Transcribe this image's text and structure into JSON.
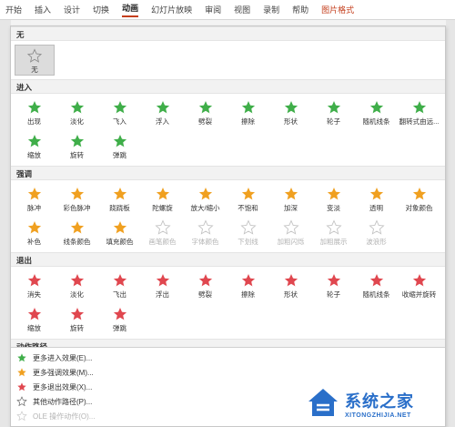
{
  "ribbon": {
    "tabs": [
      "开始",
      "插入",
      "设计",
      "切换",
      "动画",
      "幻灯片放映",
      "审阅",
      "视图",
      "录制",
      "帮助",
      "图片格式"
    ],
    "active_index": 4,
    "accent_index": 10
  },
  "none_section": {
    "header": "无",
    "item_label": "无"
  },
  "entrance": {
    "header": "进入",
    "color": "#3fae49",
    "items": [
      "出现",
      "淡化",
      "飞入",
      "浮入",
      "劈裂",
      "擦除",
      "形状",
      "轮子",
      "随机线条",
      "翻转式由远...",
      "缩放",
      "旋转",
      "弹跳"
    ]
  },
  "emphasis": {
    "header": "强调",
    "color": "#f0a020",
    "items": [
      {
        "label": "脉冲",
        "disabled": false
      },
      {
        "label": "彩色脉冲",
        "disabled": false
      },
      {
        "label": "跷跷板",
        "disabled": false
      },
      {
        "label": "陀螺旋",
        "disabled": false
      },
      {
        "label": "放大/缩小",
        "disabled": false
      },
      {
        "label": "不饱和",
        "disabled": false
      },
      {
        "label": "加深",
        "disabled": false
      },
      {
        "label": "变淡",
        "disabled": false
      },
      {
        "label": "透明",
        "disabled": false
      },
      {
        "label": "对象颜色",
        "disabled": false
      },
      {
        "label": "补色",
        "disabled": false
      },
      {
        "label": "线条颜色",
        "disabled": false
      },
      {
        "label": "填充颜色",
        "disabled": false
      },
      {
        "label": "画笔颜色",
        "disabled": true
      },
      {
        "label": "字体颜色",
        "disabled": true
      },
      {
        "label": "下划线",
        "disabled": true
      },
      {
        "label": "加粗闪烁",
        "disabled": true
      },
      {
        "label": "加粗展示",
        "disabled": true
      },
      {
        "label": "波浪形",
        "disabled": true
      }
    ]
  },
  "exit": {
    "header": "退出",
    "color": "#e0474f",
    "items": [
      "消失",
      "淡化",
      "飞出",
      "浮出",
      "劈裂",
      "擦除",
      "形状",
      "轮子",
      "随机线条",
      "收缩并旋转",
      "缩放",
      "旋转",
      "弹跳"
    ]
  },
  "motion": {
    "header": "动作路径"
  },
  "menu": {
    "items": [
      {
        "label": "更多进入效果(E)...",
        "icon": "green-star-icon",
        "color": "#3fae49",
        "disabled": false
      },
      {
        "label": "更多强调效果(M)...",
        "icon": "yellow-star-icon",
        "color": "#f0a020",
        "disabled": false
      },
      {
        "label": "更多退出效果(X)...",
        "icon": "red-star-icon",
        "color": "#e0474f",
        "disabled": false
      },
      {
        "label": "其他动作路径(P)...",
        "icon": "outline-star-icon",
        "color": "#555555",
        "disabled": false
      },
      {
        "label": "OLE 操作动作(O)...",
        "icon": "gear-icon",
        "color": "#b3b3b3",
        "disabled": true
      }
    ]
  },
  "watermark": {
    "title": "系统之家",
    "subtitle": "XITONGZHIJIA.NET"
  }
}
